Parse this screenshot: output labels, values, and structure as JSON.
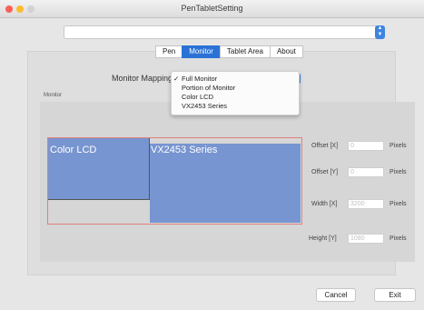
{
  "window": {
    "title": "PenTabletSetting"
  },
  "device_select": {
    "value": ""
  },
  "tabs": [
    {
      "label": "Pen",
      "active": false
    },
    {
      "label": "Monitor",
      "active": true
    },
    {
      "label": "Tablet Area",
      "active": false
    },
    {
      "label": "About",
      "active": false
    }
  ],
  "monitor_mapping": {
    "label": "Monitor Mapping",
    "checkmark": "✓",
    "options": [
      "Full Monitor",
      "Portion of Monitor",
      "Color LCD",
      "VX2453 Series"
    ],
    "selected": "Full Monitor"
  },
  "monitor_group": {
    "label": "Monitor",
    "screens": [
      "Color LCD",
      "VX2453 Series"
    ]
  },
  "fields": {
    "offset_x": {
      "label": "Offset [X]",
      "value": "0",
      "unit": "Pixels"
    },
    "offset_y": {
      "label": "Offset [Y]",
      "value": "0",
      "unit": "Pixels"
    },
    "width": {
      "label": "Width [X]",
      "value": "3200",
      "unit": "Pixels"
    },
    "height": {
      "label": "Height [Y]",
      "value": "1080",
      "unit": "Pixels"
    }
  },
  "buttons": {
    "cancel": "Cancel",
    "exit": "Exit"
  },
  "colors": {
    "accent": "#2a72d6",
    "screen_fill": "#7795d0",
    "outline_red": "#e07f7f"
  }
}
